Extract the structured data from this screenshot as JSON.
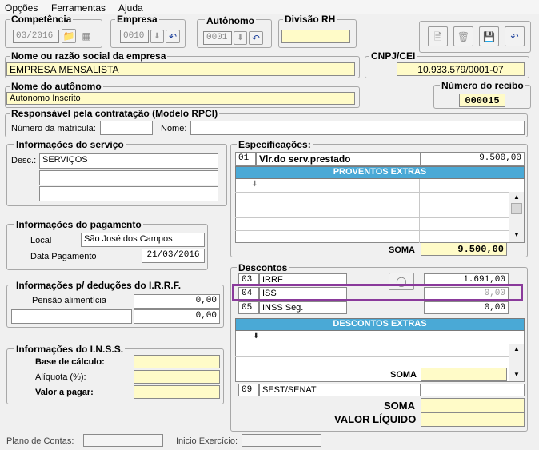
{
  "menu": {
    "items": [
      "Opções",
      "Ferramentas",
      "Ajuda"
    ]
  },
  "competencia": {
    "label": "Competência",
    "value": "03/2016"
  },
  "empresa": {
    "label": "Empresa",
    "value": "0010"
  },
  "autonomo": {
    "label": "Autônomo",
    "value": "0001"
  },
  "divisao": {
    "label": "Divisão RH",
    "value": ""
  },
  "nome_empresa": {
    "label": "Nome ou razão social da empresa",
    "value": "EMPRESA MENSALISTA"
  },
  "cnpj": {
    "label": "CNPJ/CEI",
    "value": "10.933.579/0001-07"
  },
  "nome_autonomo": {
    "label": "Nome do autônomo",
    "value": "Autonomo  Inscrito"
  },
  "recibo": {
    "label": "Número do recibo",
    "value": "000015"
  },
  "responsavel": {
    "label": "Responsável pela contratação (Modelo RPCI)",
    "matricula_label": "Número da matrícula:",
    "nome_label": "Nome:",
    "matricula": "",
    "nome": ""
  },
  "servico": {
    "label": "Informações do serviço",
    "desc_label": "Desc.:",
    "desc": [
      "SERVIÇOS",
      "",
      ""
    ]
  },
  "pagamento": {
    "label": "Informações do pagamento",
    "local_label": "Local",
    "local": "São José dos Campos",
    "data_label": "Data Pagamento",
    "data": "21/03/2016"
  },
  "irrf": {
    "label": "Informações p/ deduções do I.R.R.F.",
    "pensao_label": "Pensão alimentícia",
    "pensao": "0,00",
    "outro": "0,00"
  },
  "inss": {
    "label": "Informações do I.N.S.S.",
    "base_label": "Base de cálculo:",
    "aliquota_label": "Alíquota (%):",
    "valor_label": "Valor a pagar:"
  },
  "especificacoes": {
    "label": "Especificações:",
    "code": "01",
    "desc": "Vlr.do serv.prestado",
    "value": "9.500,00",
    "proventos_header": "PROVENTOS EXTRAS",
    "soma_label": "SOMA",
    "soma": "9.500,00"
  },
  "descontos": {
    "label": "Descontos",
    "rows": [
      {
        "code": "03",
        "desc": "IRRF",
        "value": "1.691,00"
      },
      {
        "code": "04",
        "desc": "ISS",
        "value": "0,00"
      },
      {
        "code": "05",
        "desc": "INSS Seg.",
        "value": "0,00"
      }
    ],
    "extras_header": "DESCONTOS EXTRAS",
    "soma_label": "SOMA",
    "sest_code": "09",
    "sest_desc": "SEST/SENAT"
  },
  "totais": {
    "soma_label": "SOMA",
    "liquido_label": "VALOR LÍQUIDO"
  },
  "status": {
    "plano_label": "Plano de Contas:",
    "inicio_label": "Inicio Exercício:"
  },
  "colors": {
    "accent": "#4aa9d6",
    "highlight": "#8a3a9b",
    "field_yellow": "#fffbc8"
  }
}
